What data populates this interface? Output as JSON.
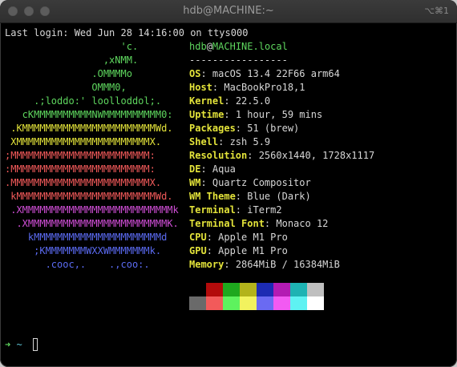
{
  "window": {
    "title": "hdb@MACHINE:~",
    "shortcut": "⌥⌘1"
  },
  "terminal": {
    "last_login": "Last login: Wed Jun 28 14:16:00 on ttys000",
    "logo": [
      {
        "text": "                    'c.",
        "color": "#5ed65e"
      },
      {
        "text": "                 ,xNMM.",
        "color": "#5ed65e"
      },
      {
        "text": "               .OMMMMo",
        "color": "#5ed65e"
      },
      {
        "text": "               OMMM0,",
        "color": "#5ed65e"
      },
      {
        "text": "     .;loddo:' loolloddol;.",
        "color": "#5ed65e"
      },
      {
        "text": "   cKMMMMMMMMMMNWMMMMMMMMMM0:",
        "color": "#5ed65e"
      },
      {
        "text": " .KMMMMMMMMMMMMMMMMMMMMMMMWd.",
        "color": "#e3e33a"
      },
      {
        "text": " XMMMMMMMMMMMMMMMMMMMMMMMX.",
        "color": "#e3e33a"
      },
      {
        "text": ";MMMMMMMMMMMMMMMMMMMMMMMM:",
        "color": "#f25a5a"
      },
      {
        "text": ":MMMMMMMMMMMMMMMMMMMMMMMM:",
        "color": "#f25a5a"
      },
      {
        "text": ".MMMMMMMMMMMMMMMMMMMMMMMMX.",
        "color": "#f25a5a"
      },
      {
        "text": " kMMMMMMMMMMMMMMMMMMMMMMMMWd.",
        "color": "#f25a5a"
      },
      {
        "text": " .XMMMMMMMMMMMMMMMMMMMMMMMMMMk",
        "color": "#cf4ed6"
      },
      {
        "text": "  .XMMMMMMMMMMMMMMMMMMMMMMMMK.",
        "color": "#cf4ed6"
      },
      {
        "text": "    kMMMMMMMMMMMMMMMMMMMMMMd",
        "color": "#5b6bf2"
      },
      {
        "text": "     ;KMMMMMMMWXXWMMMMMMMk.",
        "color": "#5b6bf2"
      },
      {
        "text": "       .cooc,.    .,coo:.",
        "color": "#5b6bf2"
      }
    ],
    "user_host": {
      "user": "hdb",
      "at": "@",
      "host": "MACHINE.local"
    },
    "separator": "-----------------",
    "info": [
      {
        "key": "OS",
        "value": "macOS 13.4 22F66 arm64"
      },
      {
        "key": "Host",
        "value": "MacBookPro18,1"
      },
      {
        "key": "Kernel",
        "value": "22.5.0"
      },
      {
        "key": "Uptime",
        "value": "1 hour, 59 mins"
      },
      {
        "key": "Packages",
        "value": "51 (brew)"
      },
      {
        "key": "Shell",
        "value": "zsh 5.9"
      },
      {
        "key": "Resolution",
        "value": "2560x1440, 1728x1117"
      },
      {
        "key": "DE",
        "value": "Aqua"
      },
      {
        "key": "WM",
        "value": "Quartz Compositor"
      },
      {
        "key": "WM Theme",
        "value": "Blue (Dark)"
      },
      {
        "key": "Terminal",
        "value": "iTerm2"
      },
      {
        "key": "Terminal Font",
        "value": "Monaco 12"
      },
      {
        "key": "CPU",
        "value": "Apple M1 Pro"
      },
      {
        "key": "GPU",
        "value": "Apple M1 Pro"
      },
      {
        "key": "Memory",
        "value": "2864MiB / 16384MiB"
      }
    ],
    "palette_top": [
      "#000000",
      "#b30b0b",
      "#1ea81e",
      "#b3b31b",
      "#1c2bb3",
      "#b31bb3",
      "#1eb3b3",
      "#bfbfbf"
    ],
    "palette_bottom": [
      "#6a6a6a",
      "#f25a5a",
      "#5ef25e",
      "#f2f25e",
      "#6a6af2",
      "#f25af2",
      "#5ef2f2",
      "#ffffff"
    ],
    "prompt": {
      "arrow": "➜",
      "dir": "~"
    }
  }
}
